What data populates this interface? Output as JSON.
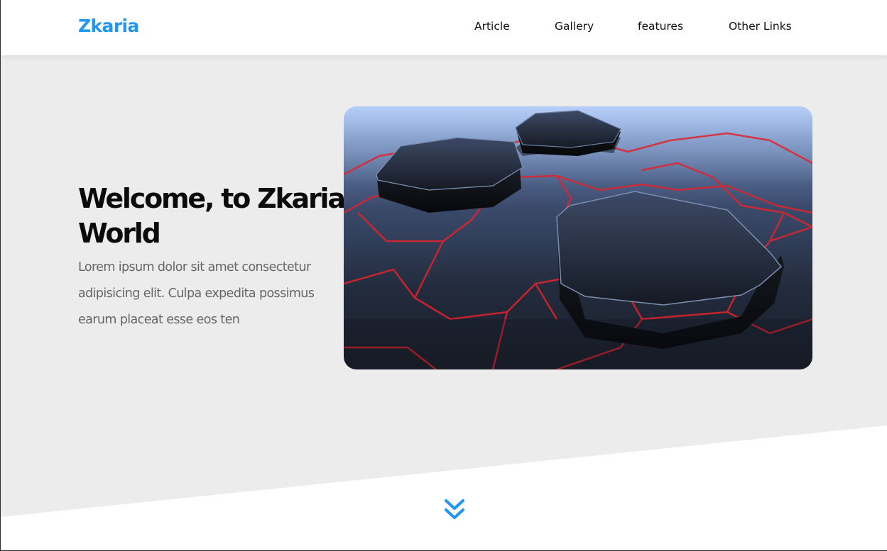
{
  "brand": {
    "name": "Zkaria"
  },
  "nav": {
    "items": [
      {
        "label": "Article"
      },
      {
        "label": "Gallery"
      },
      {
        "label": "features"
      },
      {
        "label": "Other Links"
      }
    ]
  },
  "hero": {
    "title": "Welcome, to Zkaria World",
    "text": "Lorem ipsum dolor sit amet consectetur adipisicing elit. Culpa expedita possimus earum placeat esse eos ten"
  },
  "colors": {
    "accent": "#2196f3",
    "hero_background": "#ececec",
    "title": "#0b0b0b",
    "body_text": "#666666",
    "nav_text": "#111111",
    "circuit_lines": "#e3222b"
  },
  "icons": {
    "scroll": "double-chevron-down-icon"
  }
}
